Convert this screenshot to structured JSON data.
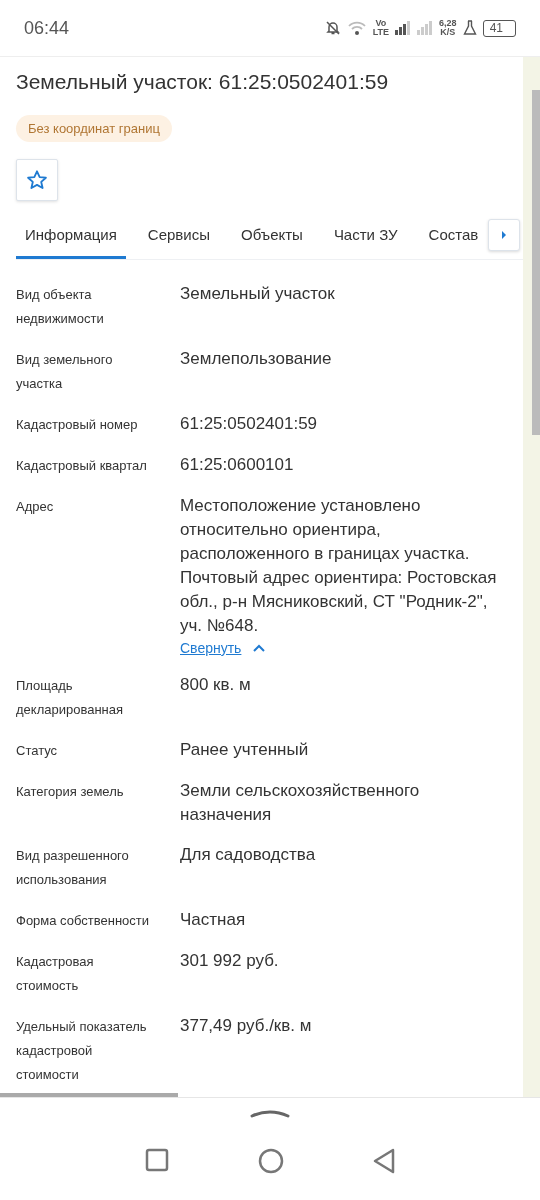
{
  "status_bar": {
    "time": "06:44",
    "volte": [
      "Vo",
      "LTE"
    ],
    "speed": [
      "6,28",
      "K/S"
    ],
    "battery": "41"
  },
  "header": {
    "title": "Земельный участок: 61:25:0502401:59",
    "badge": "Без координат границ",
    "favorite": false
  },
  "tabs": [
    {
      "label": "Информация",
      "selected": true
    },
    {
      "label": "Сервисы",
      "selected": false
    },
    {
      "label": "Объекты",
      "selected": false
    },
    {
      "label": "Части ЗУ",
      "selected": false
    },
    {
      "label": "Состав",
      "selected": false
    }
  ],
  "fields": [
    {
      "label": "Вид объекта недвижимости",
      "value": "Земельный участок"
    },
    {
      "label": "Вид земельного участка",
      "value": "Землепользование"
    },
    {
      "label": "Кадастровый номер",
      "value": "61:25:0502401:59"
    },
    {
      "label": "Кадастровый квартал",
      "value": "61:25:0600101"
    },
    {
      "label": "Адрес",
      "value": "Местоположение установлено относительно ориентира, расположенного в границах участка. Почтовый адрес ориентира: Ростовская обл., р-н Мясниковский, СТ \"Родник-2\", уч. №648.",
      "link": "Свернуть",
      "expanded": true
    },
    {
      "label": "Площадь декларированная",
      "value": "800 кв. м"
    },
    {
      "label": "Статус",
      "value": "Ранее учтенный"
    },
    {
      "label": "Категория земель",
      "value": "Земли сельскохозяйственного назначения"
    },
    {
      "label": "Вид разрешенного использования",
      "value": "Для садоводства"
    },
    {
      "label": "Форма собственности",
      "value": "Частная"
    },
    {
      "label": "Кадастровая стоимость",
      "value": "301 992 руб."
    },
    {
      "label": "Удельный показатель кадастровой стоимости",
      "value": "377,49 руб./кв. м"
    }
  ]
}
